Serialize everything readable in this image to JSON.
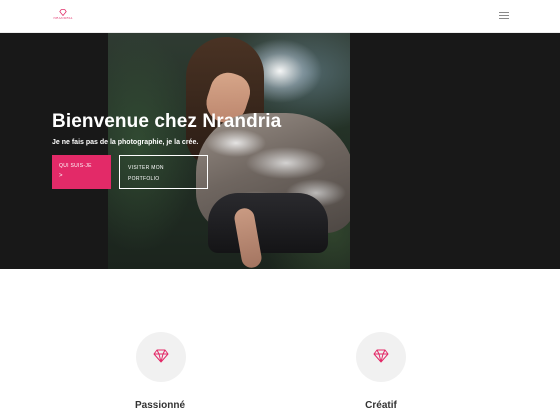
{
  "header": {
    "logo_text": "NRANDRIA",
    "menu_icon": "hamburger-menu-icon"
  },
  "hero": {
    "title": "Bienvenue chez Nrandria",
    "subtitle": "Je ne fais pas de la photographie, je la crée.",
    "primary_button": {
      "label": "QUI SUIS-JE",
      "arrow": ">"
    },
    "secondary_button": {
      "label": "VISITER MON PORTFOLIO"
    }
  },
  "features": [
    {
      "title": "Passionné",
      "icon": "diamond-icon"
    },
    {
      "title": "Créatif",
      "icon": "diamond-icon"
    }
  ],
  "colors": {
    "accent": "#e32a68",
    "hero_background": "#181818",
    "icon_circle": "#f1f1f1"
  }
}
